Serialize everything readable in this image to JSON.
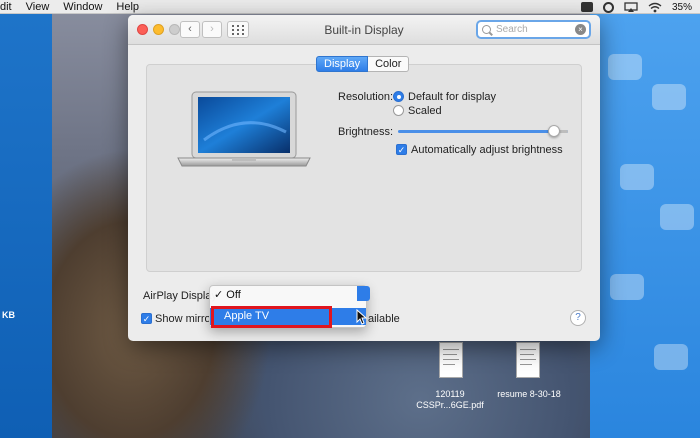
{
  "menubar": {
    "items": [
      "dit",
      "View",
      "Window",
      "Help"
    ],
    "battery": "35%"
  },
  "sidebar_left": {
    "size_label": "KB"
  },
  "window": {
    "title": "Built-in Display",
    "search_placeholder": "Search",
    "tabs": [
      {
        "label": "Display",
        "active": true
      },
      {
        "label": "Color",
        "active": false
      }
    ]
  },
  "display": {
    "resolution_label": "Resolution:",
    "resolution_options": [
      {
        "label": "Default for display",
        "selected": true
      },
      {
        "label": "Scaled",
        "selected": false
      }
    ],
    "brightness_label": "Brightness:",
    "brightness_level": 0.92,
    "auto_brightness_label": "Automatically adjust brightness",
    "auto_brightness_checked": true
  },
  "airplay": {
    "label": "AirPlay Display",
    "menu_items": [
      {
        "label": "Off",
        "checked": true
      },
      {
        "label": "Apple TV",
        "checked": false,
        "highlighted": true
      }
    ],
    "mirror_label_left": "Show mirror",
    "mirror_label_right": "ailable",
    "mirror_checked": true
  },
  "help_label": "?",
  "desktop_files": [
    {
      "line1": "120119",
      "line2": "CSSPr...6GE.pdf"
    },
    {
      "line1": "resume 8-30-18",
      "line2": ""
    }
  ],
  "colors": {
    "accent": "#2e7de8",
    "highlight_border": "#e0161f"
  }
}
